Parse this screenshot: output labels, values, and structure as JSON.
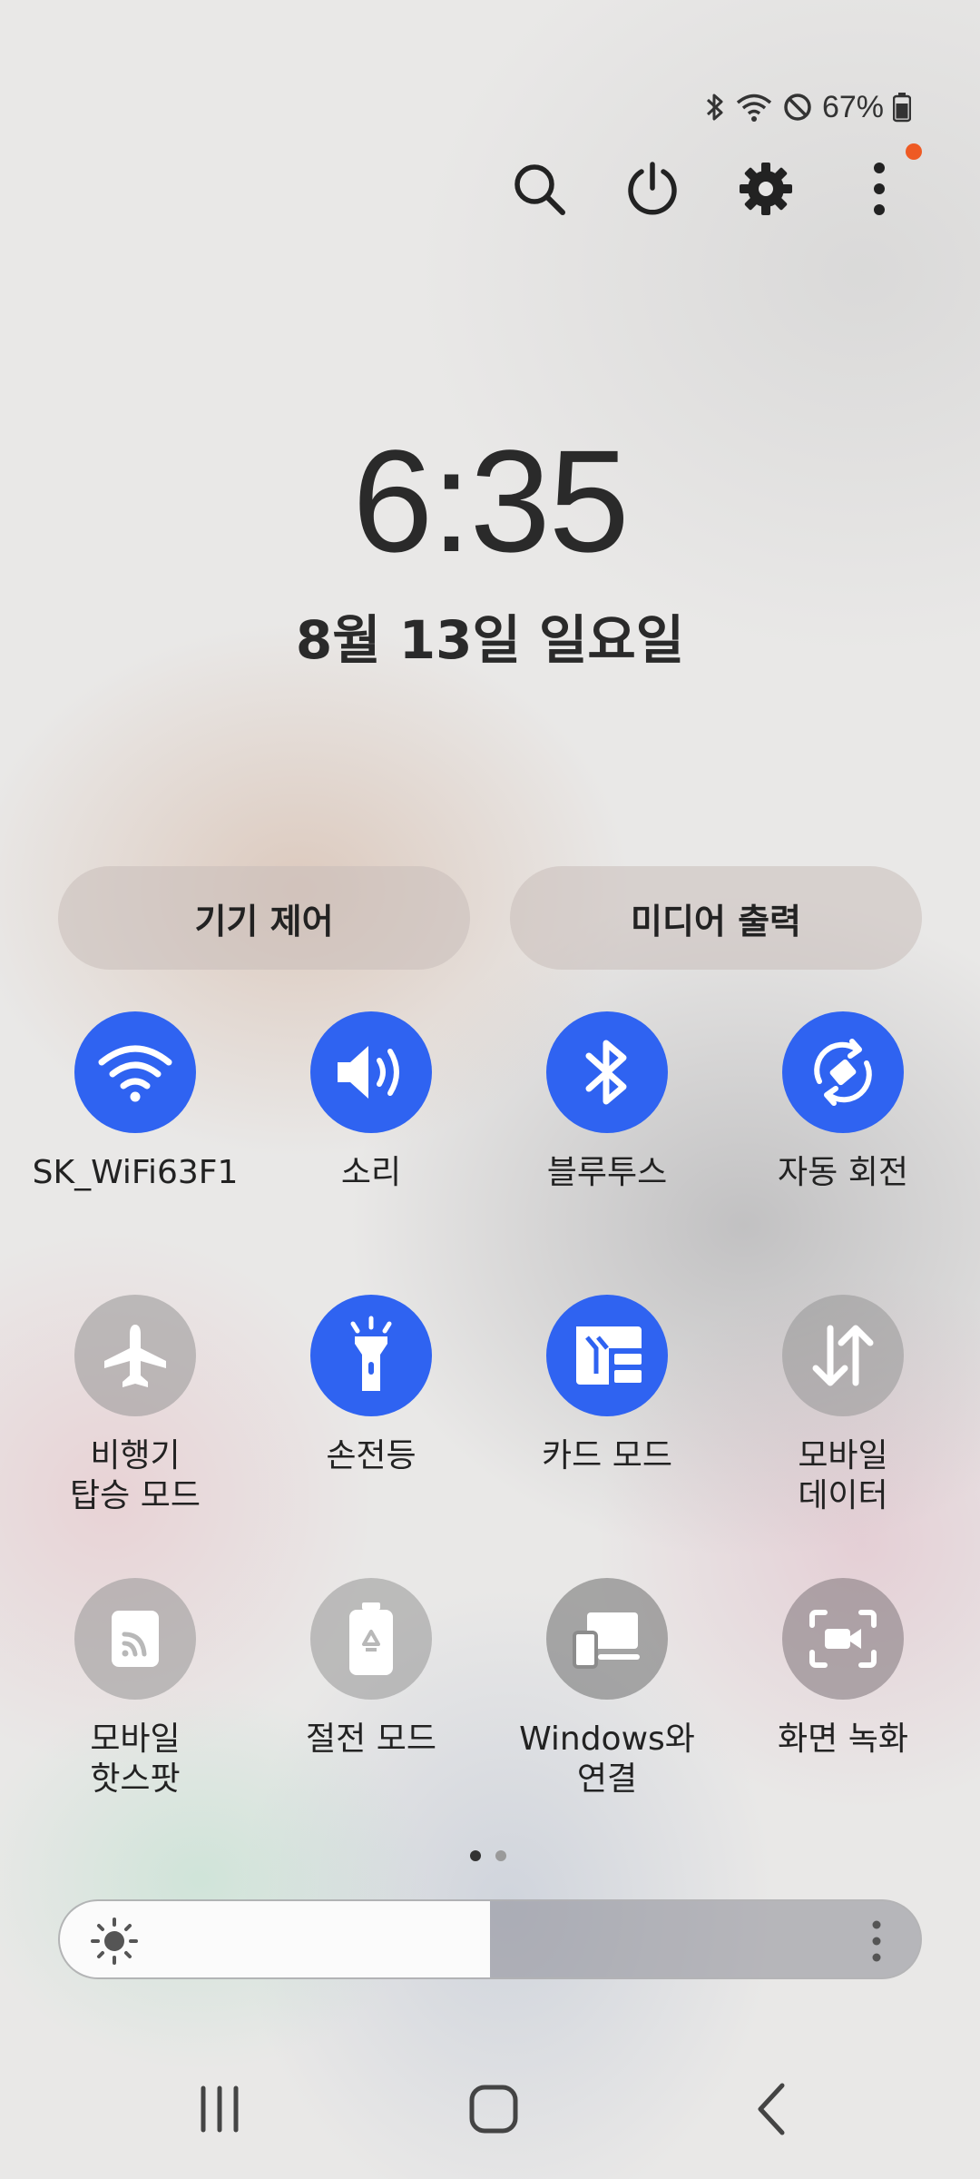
{
  "status_bar": {
    "battery_text": "67%",
    "icons": [
      "bluetooth-icon",
      "wifi-icon",
      "do-not-disturb-icon",
      "battery-icon"
    ]
  },
  "top_actions": [
    "search-icon",
    "power-icon",
    "settings-icon",
    "more-options-icon"
  ],
  "clock": {
    "time": "6:35",
    "date": "8월 13일 일요일"
  },
  "pills": {
    "device_control": "기기 제어",
    "media_output": "미디어 출력"
  },
  "quick_settings": [
    {
      "label": "SK_WiFi63F1",
      "icon": "wifi-icon",
      "active": true
    },
    {
      "label": "소리",
      "icon": "sound-icon",
      "active": true
    },
    {
      "label": "블루투스",
      "icon": "bluetooth-icon",
      "active": true
    },
    {
      "label": "자동 회전",
      "icon": "auto-rotate-icon",
      "active": true
    },
    {
      "label": "비행기\n탑승 모드",
      "icon": "airplane-icon",
      "active": false
    },
    {
      "label": "손전등",
      "icon": "flashlight-icon",
      "active": true
    },
    {
      "label": "카드 모드",
      "icon": "card-mode-icon",
      "active": true
    },
    {
      "label": "모바일\n데이터",
      "icon": "mobile-data-icon",
      "active": false
    },
    {
      "label": "모바일\n핫스팟",
      "icon": "hotspot-icon",
      "active": false
    },
    {
      "label": "절전 모드",
      "icon": "power-saving-icon",
      "active": false
    },
    {
      "label": "Windows와\n연결",
      "icon": "link-to-windows-icon",
      "active": false
    },
    {
      "label": "화면 녹화",
      "icon": "screen-recorder-icon",
      "active": false
    }
  ],
  "page_indicator": {
    "pages": 2,
    "current": 1
  },
  "brightness": {
    "level": 0.5,
    "icon": "sun-icon"
  },
  "colors": {
    "accent": "#2f63f1",
    "inactive_tile": "#9a9a9a",
    "notification_dot": "#ee5a24"
  },
  "nav_bar": [
    "recents-icon",
    "home-icon",
    "back-icon"
  ]
}
